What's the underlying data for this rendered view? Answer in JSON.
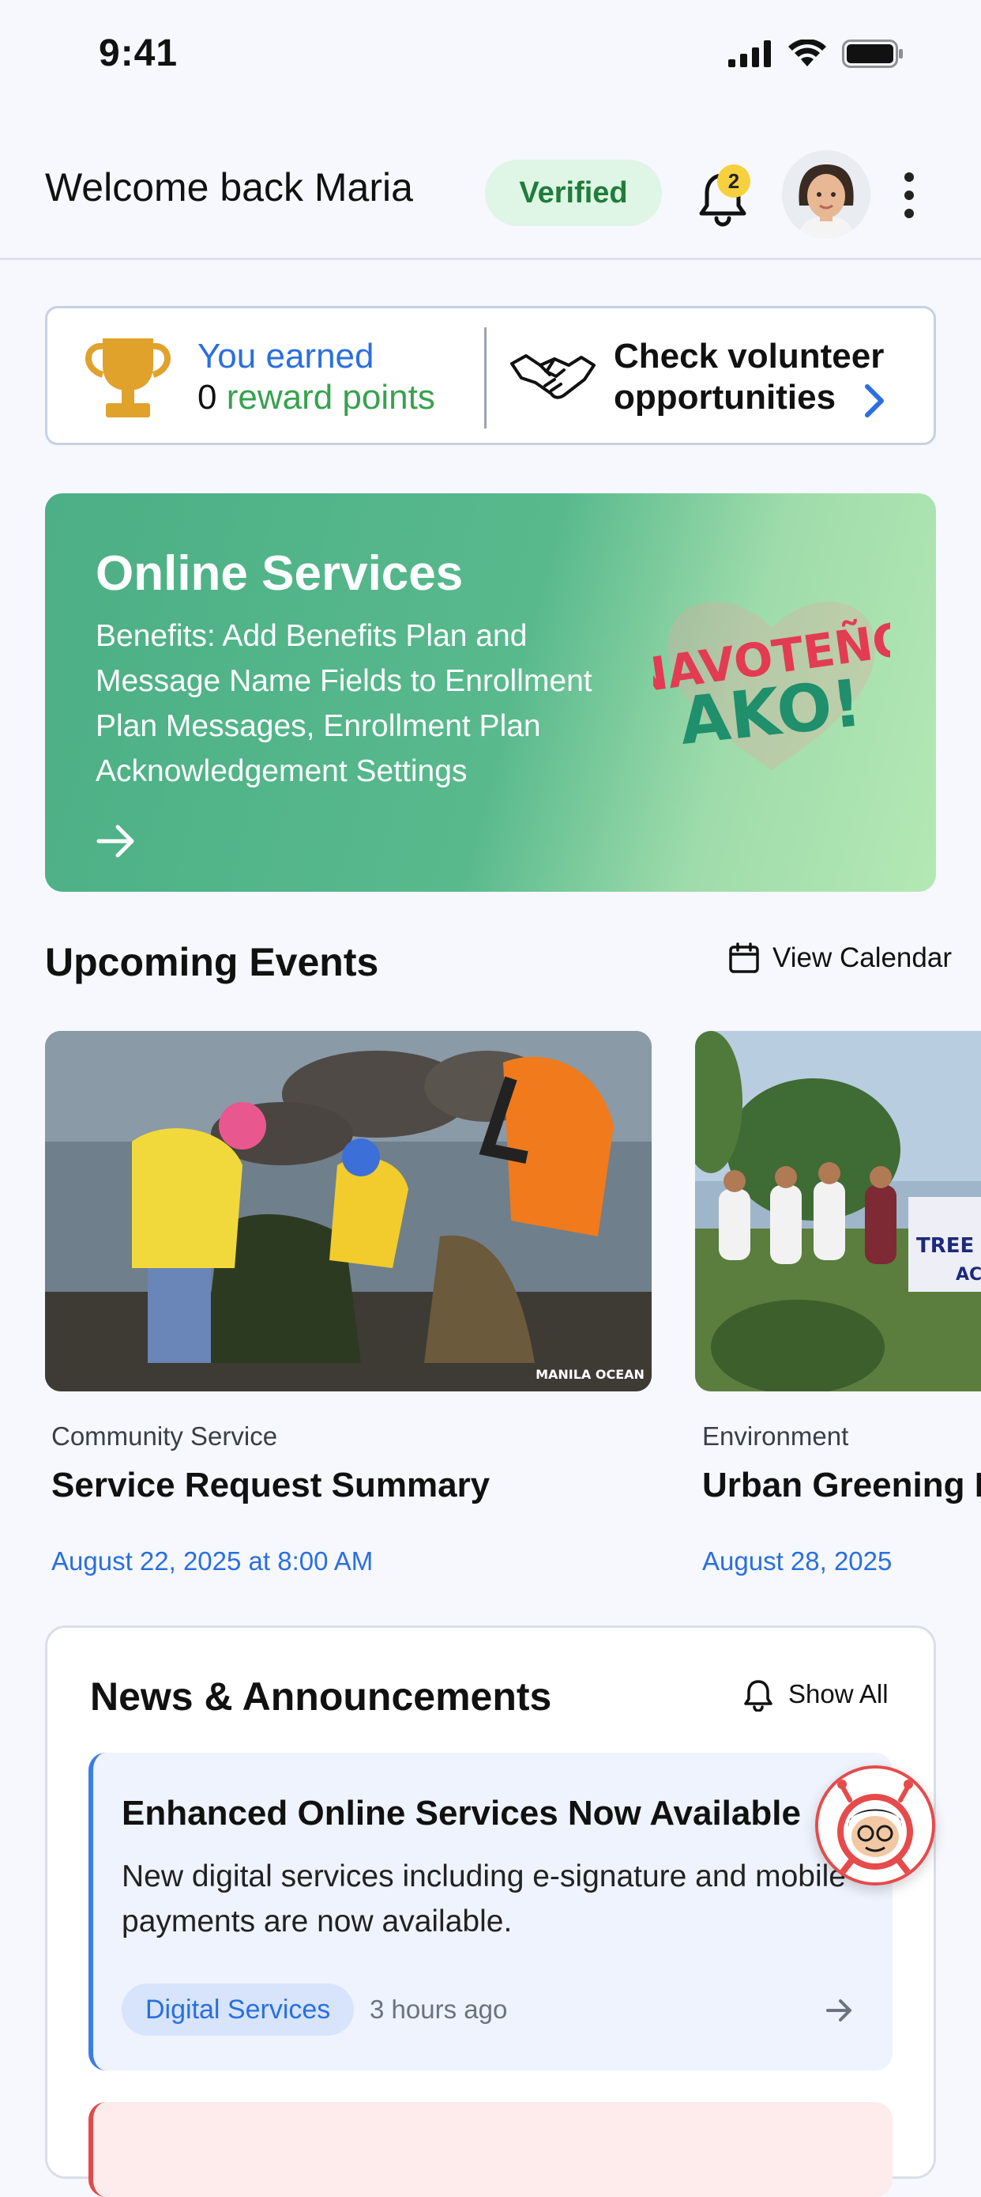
{
  "status_bar": {
    "time": "9:41"
  },
  "header": {
    "welcome": "Welcome back Maria",
    "verified_label": "Verified",
    "notification_count": "2"
  },
  "rewards": {
    "earned_prefix": "You earned",
    "points": "0",
    "points_suffix": "reward points",
    "volunteer_line1": "Check volunteer",
    "volunteer_line2": "opportunities"
  },
  "banner": {
    "title": "Online Services",
    "description": "Benefits: Add Benefits Plan and Message Name Fields to Enrollment Plan Messages, Enrollment Plan Acknowledgement Settings",
    "logo_text_1": "NAVOTEÑO",
    "logo_text_2": "AKO!"
  },
  "events": {
    "title": "Upcoming Events",
    "calendar_label": "View Calendar",
    "items": [
      {
        "category": "Community Service",
        "title": "Service Request Summary",
        "date": "August 22, 2025 at 8:00 AM",
        "watermark": "MANILA OCEAN"
      },
      {
        "category": "Environment",
        "title": "Urban Greening P",
        "date": "August 28, 2025",
        "sign_text_1": "TREE",
        "sign_text_2": "AC"
      }
    ]
  },
  "news": {
    "title": "News & Announcements",
    "show_all_label": "Show All",
    "items": [
      {
        "title": "Enhanced Online Services Now Available",
        "body": "New digital services including e-signature and mobile payments are now available.",
        "tag": "Digital Services",
        "time": "3 hours ago"
      }
    ]
  },
  "colors": {
    "accent_blue": "#2a6fe0",
    "verified_green": "#1e7d3a",
    "banner_green": "#4caf85",
    "trophy_gold": "#e0a22b"
  },
  "icons": [
    "signal-icon",
    "wifi-icon",
    "battery-icon",
    "bell-icon",
    "more-icon",
    "trophy-icon",
    "handshake-icon",
    "chevron-right-icon",
    "arrow-right-icon",
    "calendar-icon",
    "assistant-bot-icon"
  ]
}
